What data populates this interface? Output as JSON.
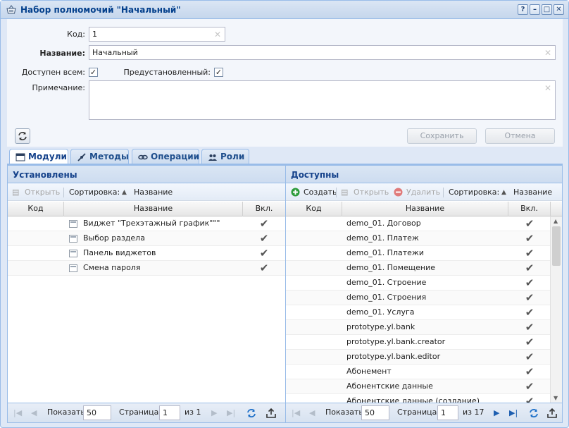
{
  "window": {
    "title": "Набор полномочий \"Начальный\"",
    "buttons": [
      "?",
      "–",
      "□",
      "✕"
    ]
  },
  "form": {
    "code_label": "Код:",
    "code_value": "1",
    "name_label": "Название:",
    "name_value": "Начальный",
    "public_label": "Доступен всем:",
    "public_checked": true,
    "preset_label": "Предустановленный:",
    "preset_checked": true,
    "note_label": "Примечание:",
    "note_value": "",
    "save_label": "Сохранить",
    "cancel_label": "Отмена"
  },
  "tabs": [
    {
      "label": "Модули",
      "icon": "module-icon",
      "active": true
    },
    {
      "label": "Методы",
      "icon": "methods-icon",
      "active": false
    },
    {
      "label": "Операции",
      "icon": "operations-icon",
      "active": false
    },
    {
      "label": "Роли",
      "icon": "roles-icon",
      "active": false
    }
  ],
  "installed": {
    "title": "Установлены",
    "toolbar": {
      "open": "Открыть",
      "sort_label": "Сортировка:",
      "sort_field": "Название"
    },
    "columns": [
      "Код",
      "Название",
      "Вкл."
    ],
    "rows": [
      {
        "code": "",
        "name": "Виджет \"Трехэтажный график\"\"\"",
        "enabled": true
      },
      {
        "code": "",
        "name": "Выбор раздела",
        "enabled": true
      },
      {
        "code": "",
        "name": "Панель виджетов",
        "enabled": true
      },
      {
        "code": "",
        "name": "Смена пароля",
        "enabled": true
      }
    ],
    "paging": {
      "show_label": "Показать",
      "page_size": "50",
      "page_label": "Страница",
      "page": "1",
      "of_label": "из 1"
    }
  },
  "available": {
    "title": "Доступны",
    "toolbar": {
      "create": "Создать",
      "open": "Открыть",
      "delete": "Удалить",
      "sort_label": "Сортировка:",
      "sort_field": "Название"
    },
    "columns": [
      "Код",
      "Название",
      "Вкл."
    ],
    "rows": [
      {
        "code": "",
        "name": "demo_01. Договор",
        "enabled": true
      },
      {
        "code": "",
        "name": "demo_01. Платеж",
        "enabled": true
      },
      {
        "code": "",
        "name": "demo_01. Платежи",
        "enabled": true
      },
      {
        "code": "",
        "name": "demo_01. Помещение",
        "enabled": true
      },
      {
        "code": "",
        "name": "demo_01. Строение",
        "enabled": true
      },
      {
        "code": "",
        "name": "demo_01. Строения",
        "enabled": true
      },
      {
        "code": "",
        "name": "demo_01. Услуга",
        "enabled": true
      },
      {
        "code": "",
        "name": "prototype.yl.bank",
        "enabled": true
      },
      {
        "code": "",
        "name": "prototype.yl.bank.creator",
        "enabled": true
      },
      {
        "code": "",
        "name": "prototype.yl.bank.editor",
        "enabled": true
      },
      {
        "code": "",
        "name": "Абонемент",
        "enabled": true
      },
      {
        "code": "",
        "name": "Абонентские данные",
        "enabled": true
      },
      {
        "code": "",
        "name": "Абонентские данные (создание)",
        "enabled": true
      }
    ],
    "paging": {
      "show_label": "Показать",
      "page_size": "50",
      "page_label": "Страница",
      "page": "1",
      "of_label": "из 17"
    }
  },
  "colors": {
    "accent": "#15428b",
    "border": "#99bce8",
    "create_green": "#2c9b3a",
    "delete_red": "#e07a7a"
  }
}
